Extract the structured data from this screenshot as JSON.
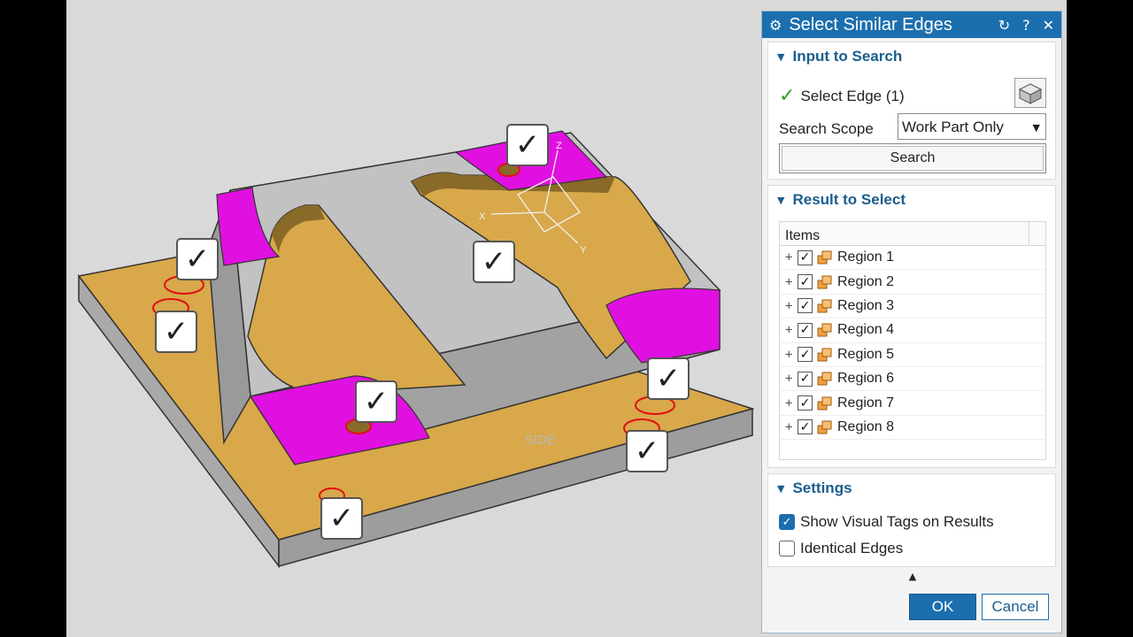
{
  "dialog": {
    "title": "Select Similar Edges",
    "icons": {
      "settings": "gear-icon",
      "reset": "reset-icon",
      "help": "help-icon",
      "close": "close-icon"
    }
  },
  "input_group": {
    "heading": "Input to Search",
    "select_edge_label": "Select Edge (1)",
    "search_scope_label": "Search Scope",
    "search_scope_value": "Work Part Only",
    "search_button": "Search"
  },
  "result_group": {
    "heading": "Result to Select",
    "column_header": "Items",
    "items": [
      {
        "label": "Region 1",
        "checked": true
      },
      {
        "label": "Region 2",
        "checked": true
      },
      {
        "label": "Region 3",
        "checked": true
      },
      {
        "label": "Region 4",
        "checked": true
      },
      {
        "label": "Region 5",
        "checked": true
      },
      {
        "label": "Region 6",
        "checked": true
      },
      {
        "label": "Region 7",
        "checked": true
      },
      {
        "label": "Region 8",
        "checked": true
      }
    ]
  },
  "settings_group": {
    "heading": "Settings",
    "show_visual_tags": {
      "label": "Show Visual Tags on Results",
      "checked": true
    },
    "identical_edges": {
      "label": "Identical Edges",
      "checked": false
    }
  },
  "footer": {
    "ok": "OK",
    "cancel": "Cancel"
  },
  "viewport": {
    "face_label": "SIDE",
    "axis_x": "X",
    "axis_y": "Y",
    "axis_z": "Z",
    "colors": {
      "body": "#bdbdbd",
      "floor": "#d8a84a",
      "highlight": "#e010e0",
      "edge": "#e01010"
    },
    "visual_tag_count": 8
  }
}
